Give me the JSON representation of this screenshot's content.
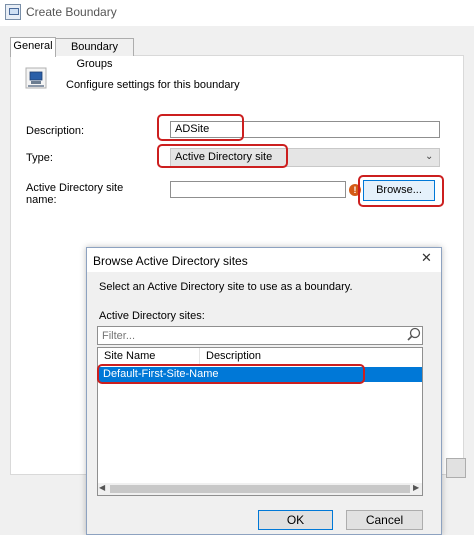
{
  "parent": {
    "title": "Create Boundary",
    "tabs": [
      {
        "label": "General"
      },
      {
        "label": "Boundary Groups"
      }
    ],
    "header_text": "Configure settings for this boundary",
    "description_label": "Description:",
    "description_value": "ADSite",
    "type_label": "Type:",
    "type_value": "Active Directory site",
    "ad_site_label": "Active Directory site name:",
    "browse_label": "Browse..."
  },
  "child": {
    "title": "Browse Active Directory sites",
    "close_glyph": "✕",
    "instructions": "Select an Active Directory site to use as a boundary.",
    "sites_label": "Active Directory sites:",
    "filter_placeholder": "Filter...",
    "columns": [
      "Site Name",
      "Description"
    ],
    "rows": [
      {
        "site_name": "Default-First-Site-Name",
        "description": ""
      }
    ],
    "ok_label": "OK",
    "cancel_label": "Cancel"
  },
  "icons": {
    "parent_title": "window-icon",
    "boundary": "computer-icon",
    "error": "error-icon",
    "filter": "search-icon",
    "dropdown": "chevron-down-icon"
  },
  "colors": {
    "highlight": "#cc1f1f",
    "selection": "#0078d7",
    "error": "#d45a16"
  }
}
